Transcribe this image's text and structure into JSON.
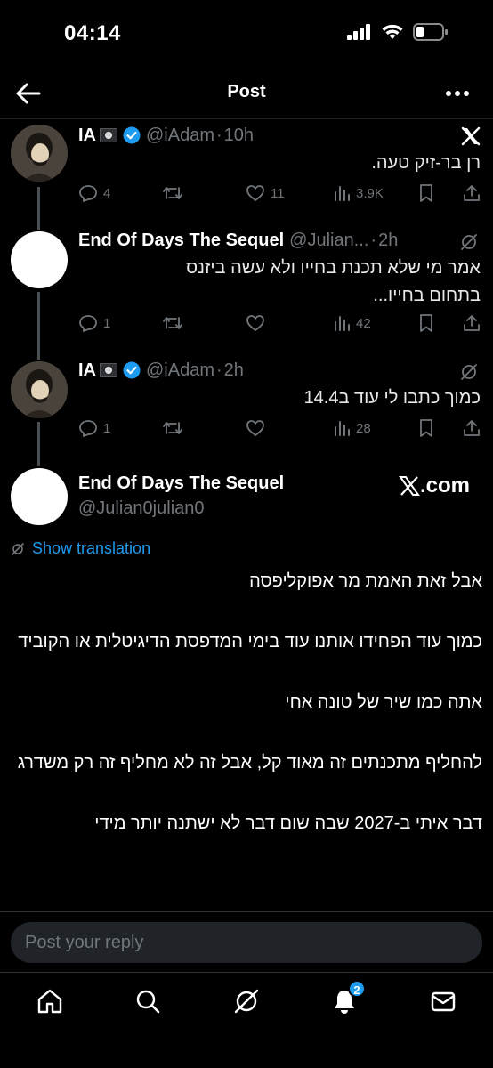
{
  "status_bar": {
    "time": "04:14"
  },
  "header": {
    "title": "Post"
  },
  "thread": [
    {
      "name": "IA",
      "handle": "@iAdam",
      "dot": "·",
      "time": "10h",
      "text": "רן בר-זיק טעה.",
      "replies": "4",
      "likes": "11",
      "views": "3.9K"
    },
    {
      "name": "End Of Days The Sequel",
      "handle": "@Julian...",
      "dot": "·",
      "time": "2h",
      "text": "אמר מי שלא תכנת בחייו ולא עשה ביזנס בתחום בחייו...",
      "replies": "1",
      "likes": "",
      "views": "42"
    },
    {
      "name": "IA",
      "handle": "@iAdam",
      "dot": "·",
      "time": "2h",
      "text": "כמוך כתבו לי עוד ב14.4",
      "replies": "1",
      "likes": "",
      "views": "28"
    }
  ],
  "main_tweet": {
    "name": "End Of Days The Sequel",
    "handle": "@Julian0julian0",
    "source": ".com",
    "show_translation": "Show translation",
    "paragraphs": [
      "אבל זאת האמת מר אפוקליפסה",
      "",
      "כמוך עוד הפחידו אותנו עוד בימי המדפסת הדיגיטלית או הקוביד",
      "",
      "אתה כמו שיר של טונה אחי",
      "",
      "להחליף מתכנתים זה מאוד קל, אבל זה לא מחליף זה רק משדרג",
      "",
      "דבר איתי ב-2027 שבה שום דבר לא ישתנה יותר מידי"
    ]
  },
  "reply": {
    "placeholder": "Post your reply"
  },
  "tabbar": {
    "notifications_badge": "2"
  },
  "colors": {
    "accent": "#1d9bf0",
    "background": "#000000",
    "muted": "#71767b"
  }
}
